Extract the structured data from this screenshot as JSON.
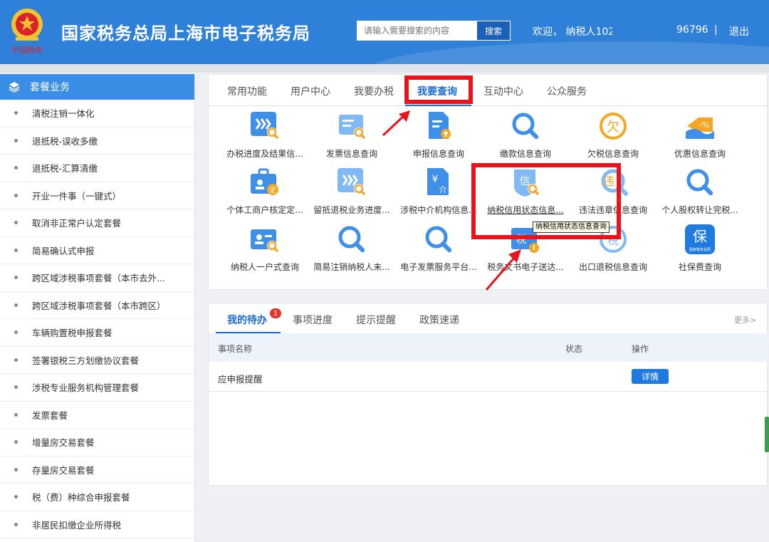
{
  "header": {
    "site_title": "国家税务总局上海市电子税务局",
    "search_placeholder": "请输入需要搜索的内容",
    "search_button": "搜索",
    "welcome_prefix": "欢迎，  纳税人102",
    "welcome_suffix": "96796",
    "separator": "|",
    "logout": "退出",
    "emblem_text": "中国税务"
  },
  "sidebar": {
    "title": "套餐业务",
    "items": [
      {
        "label": "清税注销一体化"
      },
      {
        "label": "退抵税-误收多缴"
      },
      {
        "label": "退抵税-汇算清缴"
      },
      {
        "label": "开业一件事（一键式）"
      },
      {
        "label": "取消非正常户认定套餐"
      },
      {
        "label": "简易确认式申报"
      },
      {
        "label": "跨区域涉税事项套餐（本市去外..."
      },
      {
        "label": "跨区域涉税事项套餐（本市跨区）"
      },
      {
        "label": "车辆购置税申报套餐"
      },
      {
        "label": "签署银税三方划缴协议套餐"
      },
      {
        "label": "涉税专业服务机构管理套餐"
      },
      {
        "label": "发票套餐"
      },
      {
        "label": "增量房交易套餐"
      },
      {
        "label": "存量房交易套餐"
      },
      {
        "label": "税（费）种综合申报套餐"
      },
      {
        "label": "非居民扣缴企业所得税"
      }
    ]
  },
  "tabs": [
    {
      "label": "常用功能"
    },
    {
      "label": "用户中心"
    },
    {
      "label": "我要办税"
    },
    {
      "label": "我要查询"
    },
    {
      "label": "互动中心"
    },
    {
      "label": "公众服务"
    }
  ],
  "tiles": [
    {
      "label": "办税进度及结果信...",
      "icon": "progress-icon"
    },
    {
      "label": "发票信息查询",
      "icon": "invoice-search-icon"
    },
    {
      "label": "申报信息查询",
      "icon": "declaration-icon"
    },
    {
      "label": "缴款信息查询",
      "icon": "magnifier-icon"
    },
    {
      "label": "欠税信息查询",
      "icon": "arrears-icon",
      "glyph": "欠"
    },
    {
      "label": "优惠信息查询",
      "icon": "discount-icon",
      "glyph": "-%"
    },
    {
      "label": "个体工商户核定定...",
      "icon": "business-icon",
      "glyph": "定"
    },
    {
      "label": "留抵退税业务进度...",
      "icon": "refund-progress-icon"
    },
    {
      "label": "涉税中介机构信息...",
      "icon": "agency-icon",
      "glyph": "¥介"
    },
    {
      "label": "纳税信用状态信息...",
      "icon": "credit-icon",
      "glyph": "信"
    },
    {
      "label": "违法违章信息查询",
      "icon": "violation-icon",
      "glyph": "违"
    },
    {
      "label": "个人股权转让完税...",
      "icon": "magnifier-icon"
    },
    {
      "label": "纳税人一户式查询",
      "icon": "taxpayer-card-icon"
    },
    {
      "label": "简易注销纳税人未...",
      "icon": "magnifier-icon"
    },
    {
      "label": "电子发票服务平台...",
      "icon": "magnifier-icon"
    },
    {
      "label": "税务文书电子送达...",
      "icon": "document-delivery-icon",
      "glyph": "税"
    },
    {
      "label": "出口退税信息查询",
      "icon": "export-refund-icon",
      "glyph": "税"
    },
    {
      "label": "社保费查询",
      "icon": "social-security-icon",
      "glyph": "保",
      "subtext": "国家税务总局"
    }
  ],
  "tooltip": "纳税信用状态信息查询",
  "todo": {
    "tabs": [
      {
        "label": "我的待办"
      },
      {
        "label": "事项进度"
      },
      {
        "label": "提示提醒"
      },
      {
        "label": "政策速递"
      }
    ],
    "badge": "1",
    "more": "更多>",
    "columns": [
      "事项名称",
      "状态",
      "操作"
    ],
    "rows": [
      {
        "name": "应申报提醒",
        "status": "",
        "action": "详情"
      }
    ]
  },
  "colors": {
    "header_blue": "#2f80d8",
    "accent_blue": "#1a6ad6",
    "annotation_red": "#e8141c"
  }
}
